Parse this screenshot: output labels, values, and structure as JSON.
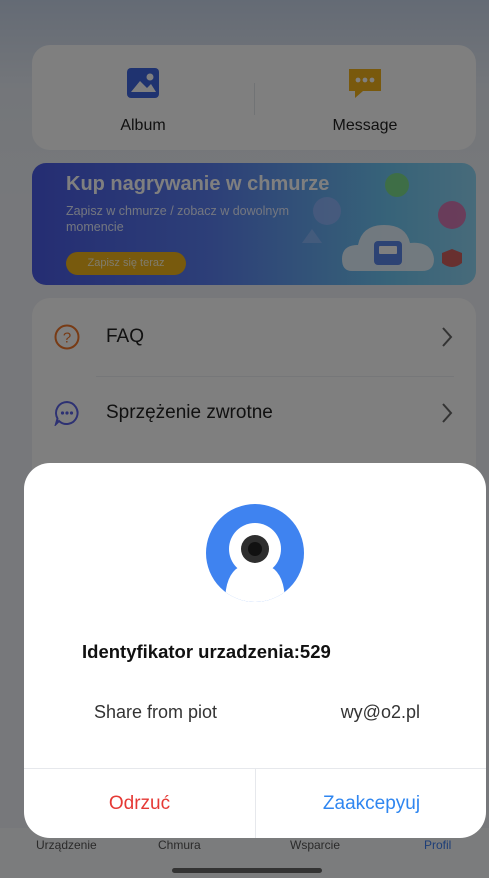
{
  "quick_actions": {
    "album_label": "Album",
    "message_label": "Message",
    "album_icon": "image-icon",
    "message_icon": "chat-icon"
  },
  "banner": {
    "title": "Kup nagrywanie w chmurze",
    "subtitle": "Zapisz w chmurze / zobacz w dowolnym momencie",
    "cta_label": "Zapisz się teraz"
  },
  "menu": {
    "items": [
      {
        "label": "FAQ",
        "icon": "question-icon"
      },
      {
        "label": "Sprzężenie zwrotne",
        "icon": "feedback-icon"
      }
    ]
  },
  "tabbar": {
    "tabs": [
      {
        "label": "Urządzenie"
      },
      {
        "label": "Chmura"
      },
      {
        "label": "Wsparcie"
      },
      {
        "label": "Profil"
      }
    ],
    "active_color": "#3b7cf0"
  },
  "dialog": {
    "device_id": "Identyfikator urzadzenia:529",
    "share_label": "Share from piot",
    "share_email": "wy@o2.pl",
    "reject_label": "Odrzuć",
    "accept_label": "Zaakcepyuj",
    "reject_color": "#e53935",
    "accept_color": "#2f86f0",
    "avatar_icon": "camera-icon"
  }
}
